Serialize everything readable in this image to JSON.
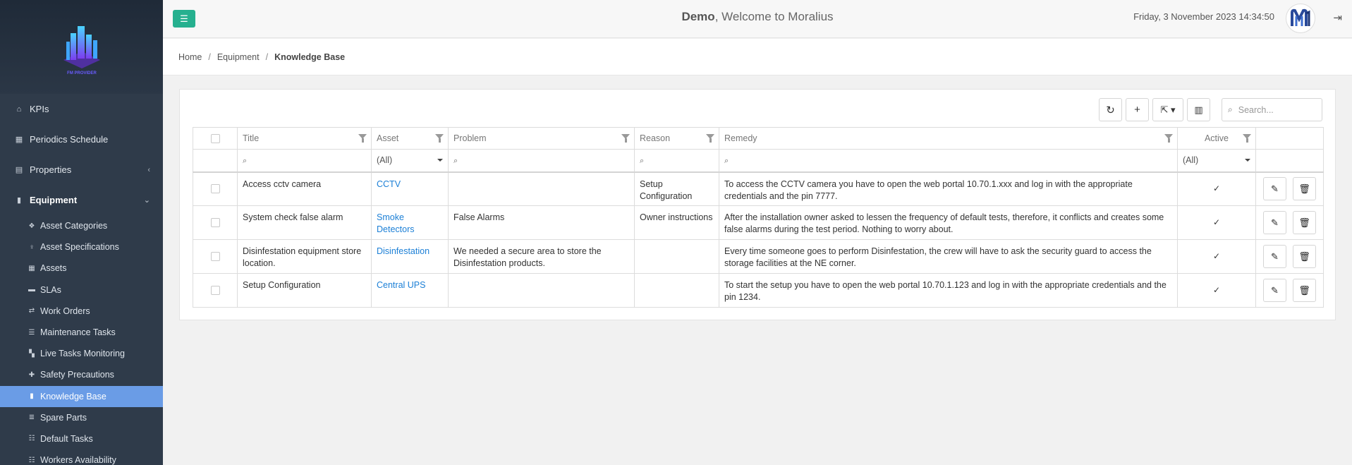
{
  "header": {
    "welcome_bold": "Demo",
    "welcome_rest": ", Welcome to Moralius",
    "datetime": "Friday, 3 November 2023 14:34:50",
    "menu_icon": "hamburger-icon",
    "avatar_letter": "M",
    "logout_icon": "logout-icon"
  },
  "brand": {
    "logo_text": "FM PROVIDER"
  },
  "sidebar": {
    "items": [
      {
        "label": "KPIs",
        "icon": "home-icon"
      },
      {
        "label": "Periodics Schedule",
        "icon": "calendar-icon"
      },
      {
        "label": "Properties",
        "icon": "building-icon",
        "chevron": "‹"
      },
      {
        "label": "Equipment",
        "icon": "book-icon",
        "chevron": "⌄"
      }
    ],
    "subitems": [
      {
        "label": "Asset Categories",
        "icon": "cubes-icon"
      },
      {
        "label": "Asset Specifications",
        "icon": "lightbulb-icon"
      },
      {
        "label": "Assets",
        "icon": "grid-icon"
      },
      {
        "label": "SLAs",
        "icon": "truck-icon"
      },
      {
        "label": "Work Orders",
        "icon": "exchange-icon"
      },
      {
        "label": "Maintenance Tasks",
        "icon": "list-icon"
      },
      {
        "label": "Live Tasks Monitoring",
        "icon": "map-icon"
      },
      {
        "label": "Safety Precautions",
        "icon": "medkit-icon"
      },
      {
        "label": "Knowledge Base",
        "icon": "book-icon",
        "active": true
      },
      {
        "label": "Spare Parts",
        "icon": "database-icon"
      },
      {
        "label": "Default Tasks",
        "icon": "list-ol-icon"
      },
      {
        "label": "Workers Availability",
        "icon": "list-ol-icon"
      }
    ]
  },
  "breadcrumb": {
    "home": "Home",
    "section": "Equipment",
    "current": "Knowledge Base",
    "separator": "/"
  },
  "toolbar": {
    "refresh_icon": "refresh-icon",
    "add_icon": "plus-icon",
    "export_icon": "export-icon",
    "columns_icon": "columns-icon",
    "search_placeholder": "Search..."
  },
  "table": {
    "columns": [
      "Title",
      "Asset",
      "Problem",
      "Reason",
      "Remedy",
      "Active"
    ],
    "filter_all": "(All)",
    "rows": [
      {
        "title": "Access cctv camera",
        "asset": "CCTV",
        "problem": "",
        "reason": "Setup Configuration",
        "remedy": "To access the CCTV camera you have to open the web portal 10.70.1.xxx and log in with the appropriate credentials and the pin 7777.",
        "active": "✓"
      },
      {
        "title": "System check false alarm",
        "asset": "Smoke Detectors",
        "problem": "False Alarms",
        "reason": "Owner instructions",
        "remedy": "After the installation owner asked to lessen the frequency of default tests, therefore, it conflicts and creates some false alarms during the test period. Nothing to worry about.",
        "active": "✓"
      },
      {
        "title": "Disinfestation equipment store location.",
        "asset": "Disinfestation",
        "problem": "We needed a secure area to store the Disinfestation products.",
        "reason": "",
        "remedy": "Every time someone goes to perform Disinfestation, the crew will have to ask the security guard to access the storage facilities at the NE corner.",
        "active": "✓"
      },
      {
        "title": "Setup Configuration",
        "asset": "Central UPS",
        "problem": "",
        "reason": "",
        "remedy": "To start the setup you have to open the web portal 10.70.1.123 and log in with the appropriate credentials and the pin 1234.",
        "active": "✓"
      }
    ]
  },
  "colors": {
    "sidebar_bg": "#2f3b4a",
    "active_item": "#6a9ce6",
    "menu_button": "#26b08f",
    "link": "#1b7fd6"
  }
}
